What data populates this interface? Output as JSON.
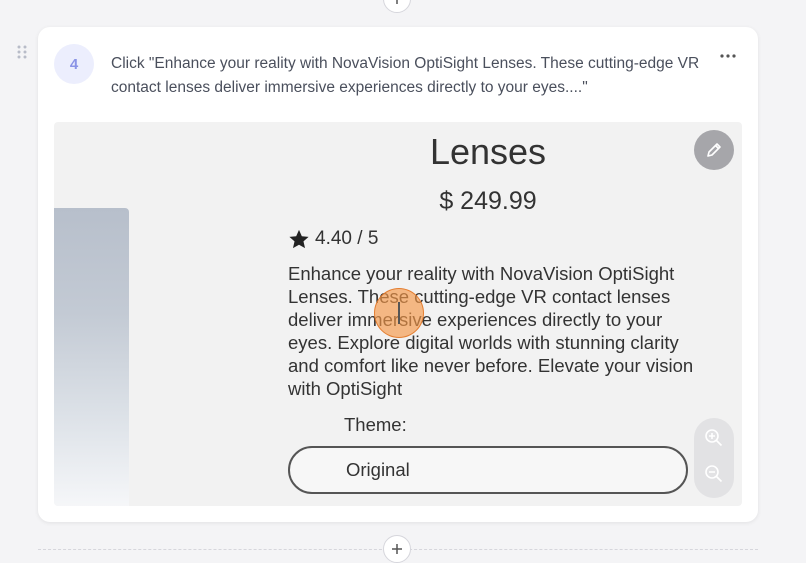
{
  "step": {
    "number": "4",
    "instruction": "Click \"Enhance your reality with NovaVision OptiSight Lenses. These cutting-edge VR contact lenses deliver immersive experiences directly to your eyes....\""
  },
  "icons": {
    "add": "plus-icon",
    "drag": "drag-handle-icon",
    "more": "more-horizontal-icon",
    "edit": "pencil-icon",
    "zoom_in": "zoom-in-icon",
    "zoom_out": "zoom-out-icon",
    "rating": "star-icon"
  },
  "screenshot": {
    "product_title": "Lenses",
    "price": "$ 249.99",
    "rating": "4.40 / 5",
    "description": "Enhance your reality with NovaVision OptiSight Lenses. These cutting-edge VR contact lenses deliver immersive experiences directly to your eyes. Explore digital worlds with stunning clarity and comfort like never before. Elevate your vision with OptiSight",
    "theme_label": "Theme:",
    "theme_value": "Original"
  },
  "colors": {
    "accent": "#8a93e6",
    "badge_bg": "#eceefd",
    "click_marker": "#f59646"
  }
}
